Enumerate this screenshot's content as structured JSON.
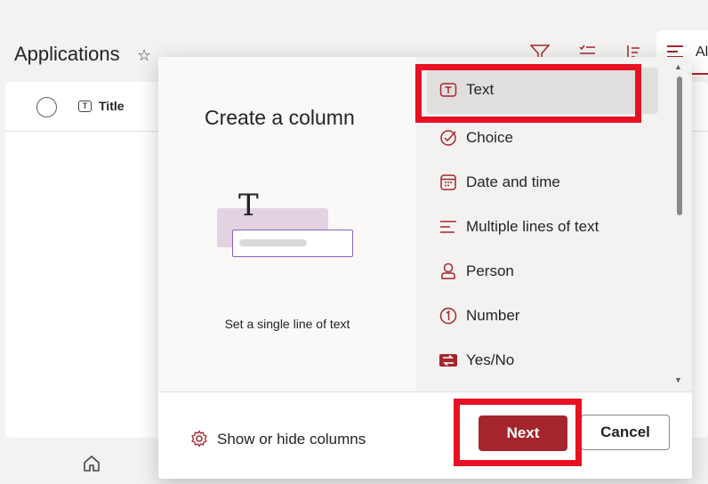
{
  "page": {
    "title": "Applications",
    "view_label": "Al",
    "title_column": "Title"
  },
  "dialog": {
    "title": "Create a column",
    "preview_description": "Set a single line of text",
    "column_types": [
      {
        "label": "Text",
        "icon": "text-field-icon",
        "selected": true
      },
      {
        "label": "Choice",
        "icon": "choice-check-icon",
        "selected": false
      },
      {
        "label": "Date and time",
        "icon": "calendar-icon",
        "selected": false
      },
      {
        "label": "Multiple lines of text",
        "icon": "multiline-text-icon",
        "selected": false
      },
      {
        "label": "Person",
        "icon": "person-icon",
        "selected": false
      },
      {
        "label": "Number",
        "icon": "number-icon",
        "selected": false
      },
      {
        "label": "Yes/No",
        "icon": "yes-no-toggle-icon",
        "selected": false
      }
    ],
    "footer": {
      "show_hide": "Show or hide columns",
      "next": "Next",
      "cancel": "Cancel"
    }
  },
  "colors": {
    "accent": "#a4262c",
    "highlight": "#e81123"
  }
}
